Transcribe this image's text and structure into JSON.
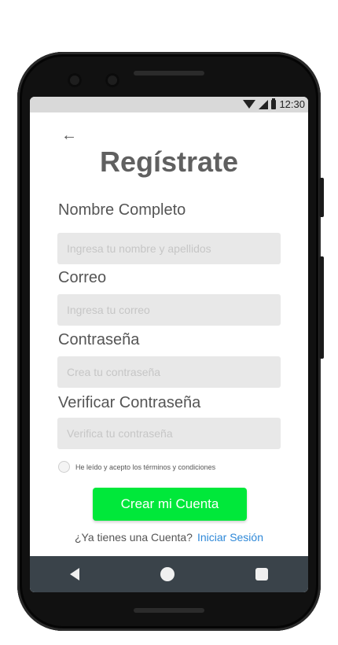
{
  "status": {
    "time": "12:30",
    "icons": [
      "wifi-icon",
      "signal-icon",
      "battery-icon"
    ]
  },
  "header": {
    "back_icon": "arrow-left-icon",
    "title": "Regístrate"
  },
  "form": {
    "name_label": "Nombre Completo",
    "name_placeholder": "Ingresa tu nombre y apellidos",
    "email_label": "Correo",
    "email_placeholder": "Ingresa tu correo",
    "password_label": "Contraseña",
    "password_placeholder": "Crea tu contraseña",
    "verify_label": "Verificar Contraseña",
    "verify_placeholder": "Verifica tu contraseña",
    "terms_text": "He leído y acepto los términos y condiciones",
    "terms_checked": false,
    "submit_label": "Crear mi Cuenta",
    "has_account_text": "¿Ya tienes una Cuenta?",
    "login_link": "Iniciar Sesión"
  },
  "nav": {
    "icons": [
      "back-triangle-icon",
      "home-circle-icon",
      "recent-square-icon"
    ]
  },
  "colors": {
    "accent": "#00e83a",
    "link": "#2e88d8",
    "title": "#606060",
    "field_bg": "#e8e8e8",
    "navbar": "#3a434a"
  }
}
